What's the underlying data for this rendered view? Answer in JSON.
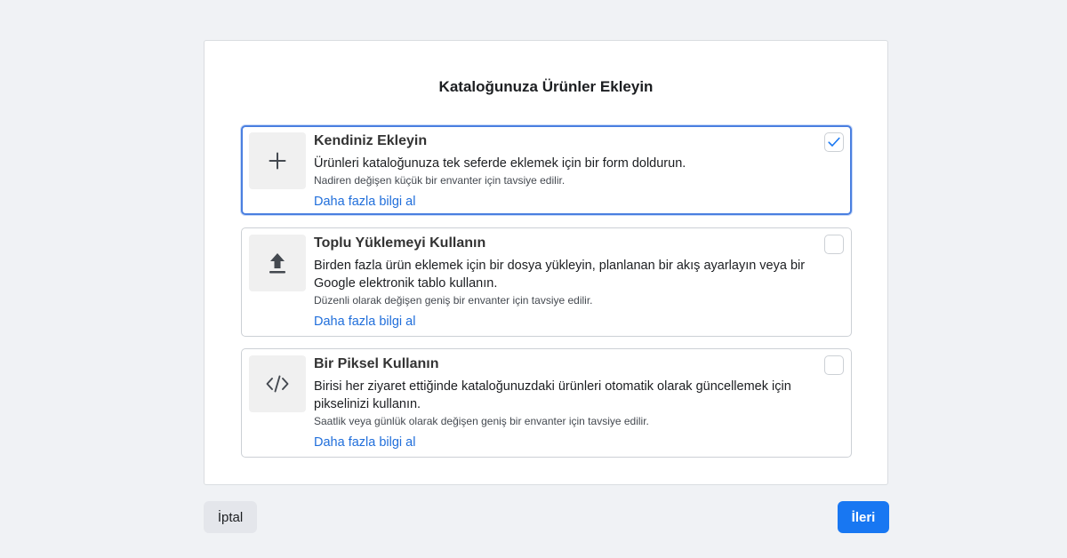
{
  "dialog": {
    "title": "Kataloğunuza Ürünler Ekleyin"
  },
  "options": [
    {
      "title": "Kendiniz Ekleyin",
      "description": "Ürünleri kataloğunuza tek seferde eklemek için bir form doldurun.",
      "note": "Nadiren değişen küçük bir envanter için tavsiye edilir.",
      "link": "Daha fazla bilgi al",
      "icon": "plus-icon",
      "selected": true
    },
    {
      "title": "Toplu Yüklemeyi Kullanın",
      "description": "Birden fazla ürün eklemek için bir dosya yükleyin, planlanan bir akış ayarlayın veya bir Google elektronik tablo kullanın.",
      "note": "Düzenli olarak değişen geniş bir envanter için tavsiye edilir.",
      "link": "Daha fazla bilgi al",
      "icon": "upload-icon",
      "selected": false
    },
    {
      "title": "Bir Piksel Kullanın",
      "description": "Birisi her ziyaret ettiğinde kataloğunuzdaki ürünleri otomatik olarak güncellemek için pikselinizi kullanın.",
      "note": "Saatlik veya günlük olarak değişen geniş bir envanter için tavsiye edilir.",
      "link": "Daha fazla bilgi al",
      "icon": "code-icon",
      "selected": false
    }
  ],
  "footer": {
    "cancel_label": "İptal",
    "next_label": "İleri"
  },
  "colors": {
    "accent": "#1877f2",
    "selected_border": "#4a7fe0",
    "link": "#216fdb"
  }
}
